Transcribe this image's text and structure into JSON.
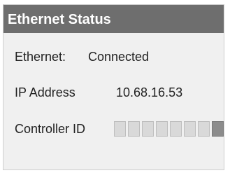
{
  "panel": {
    "title": "Ethernet Status",
    "ethernet": {
      "label": "Ethernet:",
      "value": "Connected"
    },
    "ip": {
      "label": "IP Address",
      "value": "10.68.16.53"
    },
    "controller_id": {
      "label": "Controller ID",
      "bits": [
        false,
        false,
        false,
        false,
        false,
        false,
        false,
        true
      ]
    }
  },
  "colors": {
    "header_bg": "#6e6e6e",
    "bit_off": "#d9d9d9",
    "bit_on": "#8c8c8c"
  }
}
